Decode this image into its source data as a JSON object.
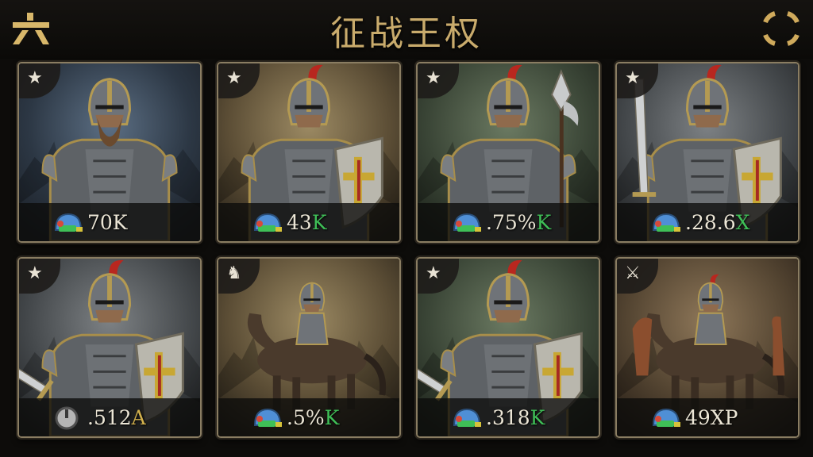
{
  "header": {
    "menu_icon": "menu-glyph-icon",
    "title": "征战王权",
    "target_icon": "target-icon"
  },
  "units": [
    {
      "badge": "★",
      "badge_icon": "star-icon",
      "stat_icon": "helmet-icon",
      "stat_value": "70K",
      "stat_suffix": "",
      "theme": "blue",
      "unit_type": "heavy-knight"
    },
    {
      "badge": "★",
      "badge_icon": "star-icon",
      "stat_icon": "helmet-icon",
      "stat_value": "43",
      "stat_suffix": "K",
      "theme": "tan",
      "unit_type": "shield-soldier"
    },
    {
      "badge": "★",
      "badge_icon": "star-icon",
      "stat_icon": "helmet-icon",
      "stat_value": ".75%",
      "stat_suffix": "K",
      "theme": "green",
      "unit_type": "halberdier"
    },
    {
      "badge": "★",
      "badge_icon": "star-icon",
      "stat_icon": "helmet-icon",
      "stat_value": ".28.6",
      "stat_suffix": "X",
      "theme": "grey",
      "unit_type": "swordsman"
    },
    {
      "badge": "★",
      "badge_icon": "star-icon",
      "stat_icon": "power-icon",
      "stat_value": ".512",
      "stat_suffix": "A",
      "theme": "grey",
      "unit_type": "berserker"
    },
    {
      "badge": "♞",
      "badge_icon": "horse-icon",
      "stat_icon": "helmet-icon",
      "stat_value": ".5%",
      "stat_suffix": "K",
      "theme": "tan",
      "unit_type": "cavalry"
    },
    {
      "badge": "★",
      "badge_icon": "star-icon",
      "stat_icon": "helmet-icon",
      "stat_value": ".318",
      "stat_suffix": "K",
      "theme": "green",
      "unit_type": "sword-shield"
    },
    {
      "badge": "⚔",
      "badge_icon": "sword-icon",
      "stat_icon": "helmet-icon",
      "stat_value": "49XP",
      "stat_suffix": "",
      "theme": "brown",
      "unit_type": "knight-cavalry"
    }
  ]
}
